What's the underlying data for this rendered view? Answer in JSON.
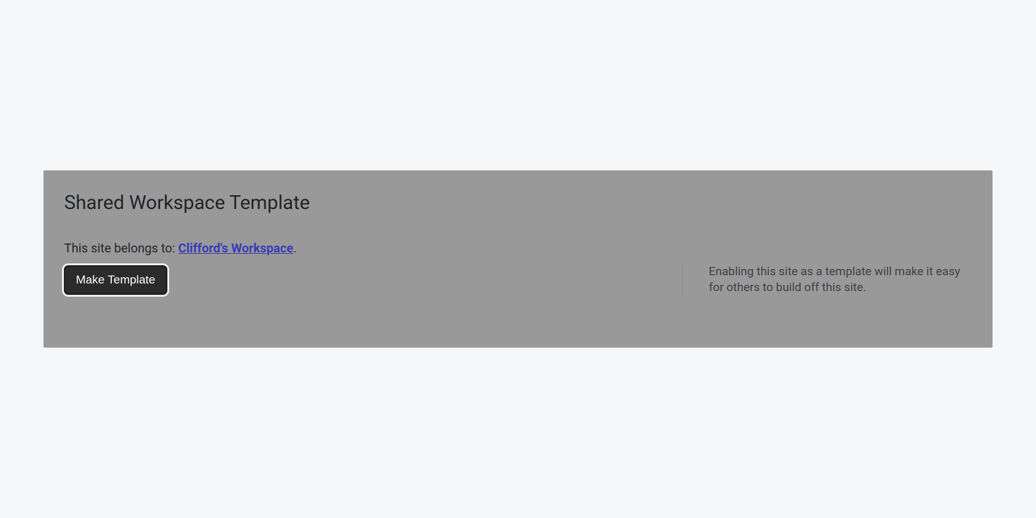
{
  "panel": {
    "title": "Shared Workspace Template",
    "belongs_prefix": "This site belongs to: ",
    "workspace_name": "Clifford's Workspace",
    "belongs_suffix": ".",
    "make_template_label": "Make Template",
    "help_text": "Enabling this site as a template will make it easy for others to build off this site."
  }
}
